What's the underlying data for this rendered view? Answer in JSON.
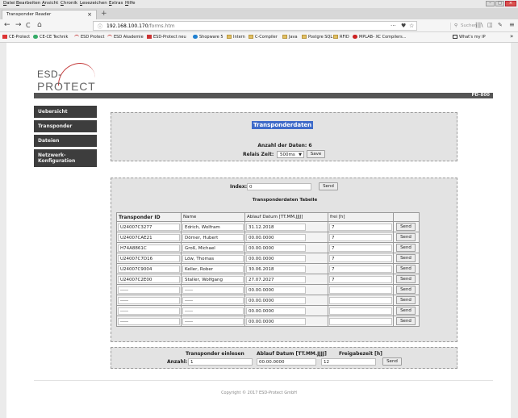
{
  "menu": [
    "Datei",
    "Bearbeiten",
    "Ansicht",
    "Chronik",
    "Lesezeichen",
    "Extras",
    "Hilfe"
  ],
  "tab": {
    "title": "Transponder Reader",
    "close": "×",
    "new": "+"
  },
  "nav": {
    "back": "←",
    "forward": "→",
    "reload": "C",
    "home": "⌂",
    "info": "ⓘ",
    "url_host": "192.168.100.170",
    "url_path": "/forms.htm",
    "more": "···",
    "pocket": "♥",
    "star": "☆",
    "search_placeholder": "Suchen",
    "library": "|||\\",
    "sidebar": "◫",
    "addons": "✎",
    "menu": "≡"
  },
  "bookmarks": [
    "CE-Protect",
    "CE-CE Technik",
    "ESD Protect",
    "ESD Akademie",
    "ESD-Protect neu",
    "Shopware 5",
    "Intern",
    "C-Compiler",
    "Java",
    "Postgre SQL",
    "RFID",
    "MPLAB- XC Compilers...",
    "What's my IP"
  ],
  "bookmarks_overflow": "»",
  "logo": {
    "line1": "ESD-",
    "line2": "PROTECT"
  },
  "device_id": "PD-800",
  "sidebar": [
    "Uebersicht",
    "Transponder",
    "Dateien",
    "Netzwerk-\nKonfiguration"
  ],
  "panel1": {
    "title": "Transponderdaten",
    "count_label": "Anzahl der Daten: 6",
    "relais_label": "Relais Zeit:",
    "relais_value": "500ms",
    "save": "Save"
  },
  "panel2": {
    "index_label": "Index:",
    "index_value": "0",
    "send": "Send",
    "subtitle": "Transponderdaten Tabelle",
    "headers": [
      "Transponder ID",
      "Name",
      "Ablauf Datum [TT.MM.JJJJ]",
      "frei [h]"
    ],
    "rows": [
      [
        "U24007C3277",
        "Edrich, Wolfram",
        "31.12.2018",
        "7"
      ],
      [
        "U24007CAE21",
        "Dörner, Hubert",
        "00.00.0000",
        "7"
      ],
      [
        "H74A8861C",
        "Groß, Michael",
        "00.00.0000",
        "7"
      ],
      [
        "U24007C7D16",
        "Löw, Thomas",
        "00.00.0000",
        "7"
      ],
      [
        "U24007C9004",
        "Keller, Rober",
        "30.06.2018",
        "7"
      ],
      [
        "U24007C2E00",
        "Staller, Wolfgang",
        "27.07.2027",
        "7"
      ],
      [
        "-----",
        "-----",
        "00.00.0000",
        ""
      ],
      [
        "-----",
        "-----",
        "00.00.0000",
        ""
      ],
      [
        "-----",
        "-----",
        "00.00.0000",
        ""
      ],
      [
        "-----",
        "-----",
        "00.00.0000",
        ""
      ]
    ]
  },
  "panel3": {
    "h1": "Transponder einlesen",
    "h2": "Ablauf Datum [TT.MM.JJJJ]",
    "h3": "Freigabezeit [h]",
    "count_label": "Anzahl:",
    "count_value": "1",
    "date_value": "00.00.0000",
    "time_value": "12",
    "send": "Send"
  },
  "footer": "Copyright © 2017 ESD-Protect GmbH",
  "colors": {
    "nav_bg": "#3d3d3d",
    "title_highlight": "#3f6bc9",
    "logo_arc": "#c43a3a"
  }
}
